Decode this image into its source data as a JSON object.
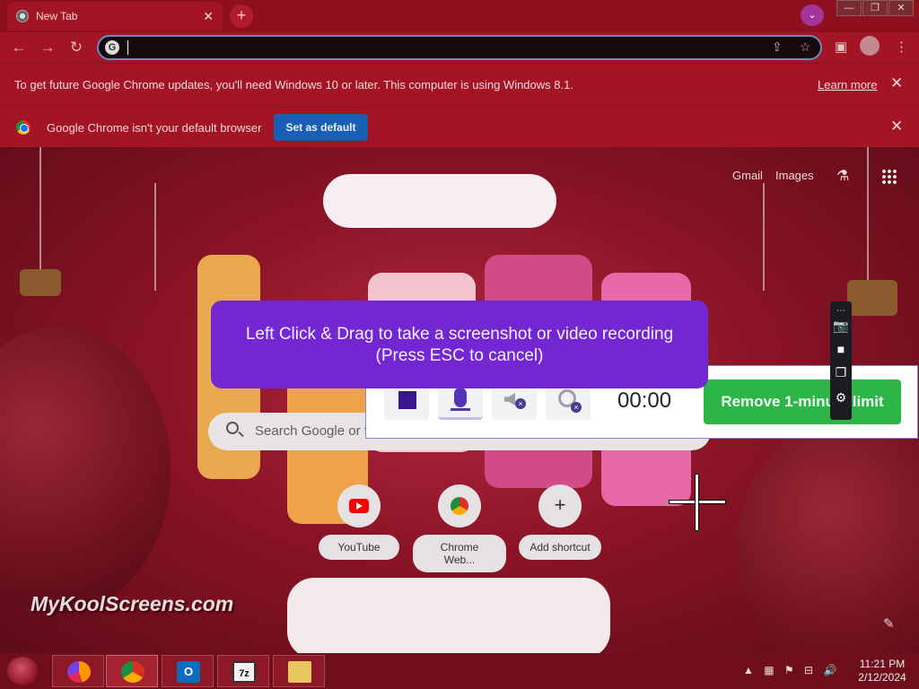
{
  "browser": {
    "tab_title": "New Tab",
    "tab_close": "✕",
    "new_tab": "+",
    "url": "",
    "window_controls": [
      "—",
      "❐",
      "✕"
    ]
  },
  "infobars": {
    "update": {
      "text": "To get future Google Chrome updates, you'll need Windows 10 or later. This computer is using Windows 8.1.",
      "link": "Learn more",
      "close": "✕"
    },
    "default_browser": {
      "text": "Google Chrome isn't your default browser",
      "button": "Set as default",
      "close": "✕"
    }
  },
  "ntp": {
    "links": [
      "Gmail",
      "Images"
    ],
    "search_placeholder": "Search Google or type a URL",
    "shortcuts": [
      {
        "label": "YouTube",
        "icon": "youtube-icon"
      },
      {
        "label": "Chrome Web...",
        "icon": "chrome-web-store-icon"
      },
      {
        "label": "Add shortcut",
        "icon": "plus-icon"
      }
    ]
  },
  "capture_overlay": {
    "hint_line1": "Left Click & Drag to take a screenshot or video recording",
    "hint_line2": "(Press ESC to cancel)",
    "timer": "00:00",
    "upgrade_button": "Remove 1-minute limit"
  },
  "watermark": "MyKoolScreens.com",
  "taskbar": {
    "apps": [
      "firefox-icon",
      "chrome-icon",
      "outlook-icon",
      "7zip-icon",
      "file-explorer-icon"
    ],
    "time": "11:21 PM",
    "date": "2/12/2024"
  },
  "colors": {
    "accent_purple": "#7327d3",
    "remove_button_green": "#2db548",
    "set_default_blue": "#1a5fb4"
  }
}
